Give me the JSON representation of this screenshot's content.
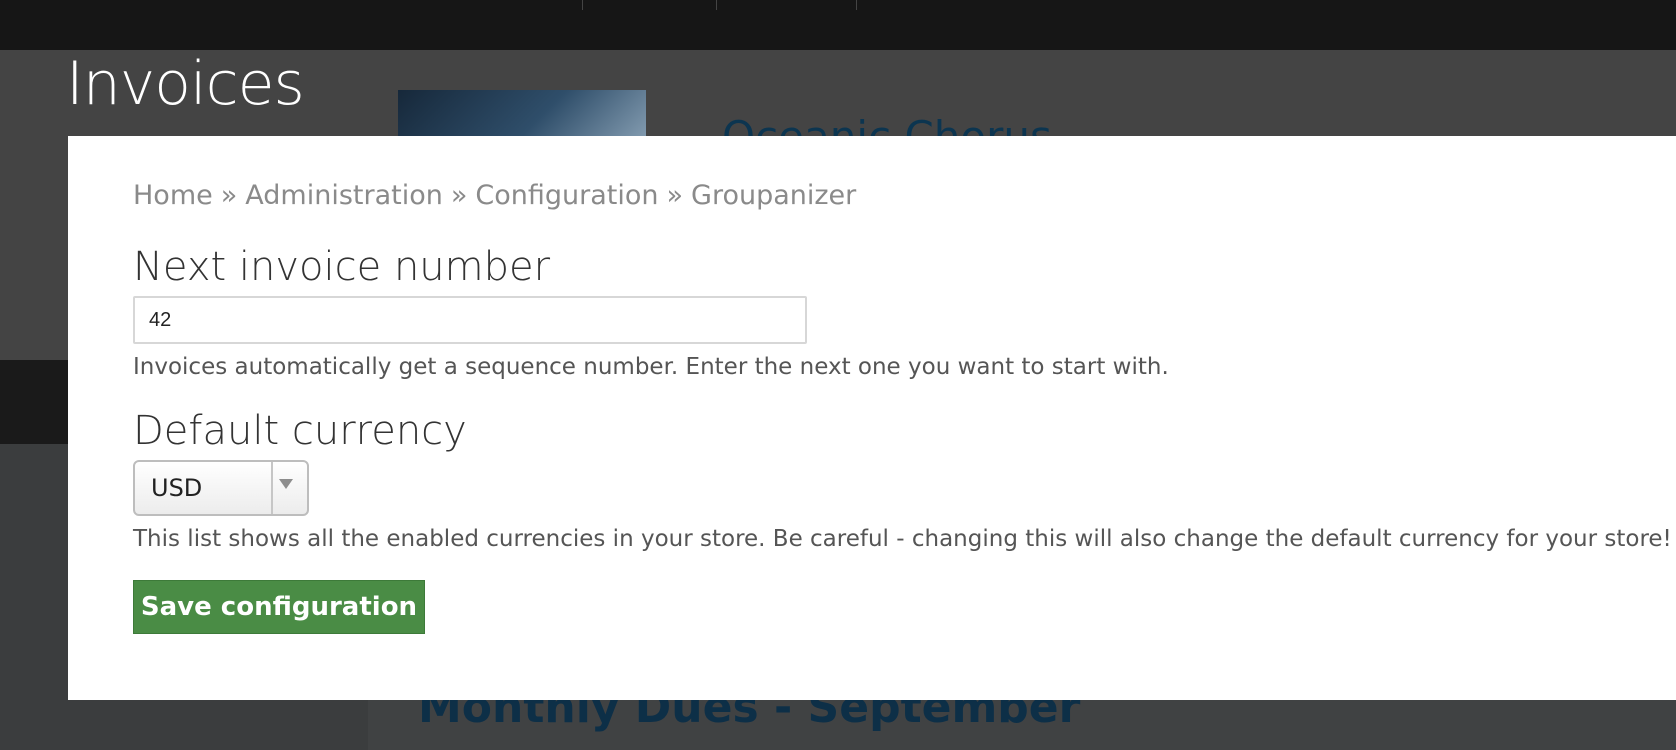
{
  "background": {
    "page_title": "Invoices",
    "group_title": "Oceanic Chorus",
    "group_subtitle": "",
    "dues_title": "Monthly Dues - September"
  },
  "breadcrumb": {
    "home": "Home",
    "separator": "»",
    "administration": "Administration",
    "configuration": "Configuration",
    "groupanizer": "Groupanizer"
  },
  "form": {
    "invoice_number": {
      "label": "Next invoice number",
      "value": "42",
      "description": "Invoices automatically get a sequence number. Enter the next one you want to start with."
    },
    "currency": {
      "label": "Default currency",
      "selected": "USD",
      "description": "This list shows all the enabled currencies in your store. Be careful - changing this will also change the default currency for your store!"
    },
    "save_label": "Save configuration"
  },
  "colors": {
    "save_button": "#4a8c45",
    "overlay_background": "#2f3132",
    "modal_background": "#ffffff"
  }
}
